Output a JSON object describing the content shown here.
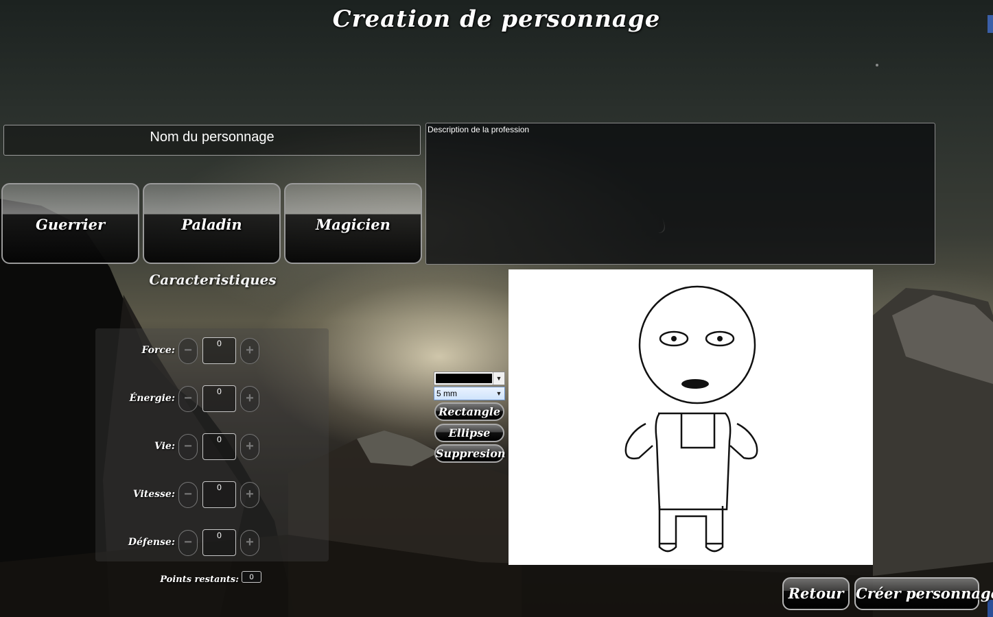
{
  "window": {
    "title": "Creation de personnage"
  },
  "name_field": {
    "value": "Nom du personnage"
  },
  "description": {
    "text": "Description de la profession"
  },
  "classes": [
    {
      "label": "Guerrier"
    },
    {
      "label": "Paladin"
    },
    {
      "label": "Magicien"
    }
  ],
  "characteristics": {
    "title": "Caracteristiques",
    "stats": [
      {
        "label": "Force:",
        "value": "0",
        "minus": "−",
        "plus": "+"
      },
      {
        "label": "Énergie:",
        "value": "0",
        "minus": "−",
        "plus": "+"
      },
      {
        "label": "Vie:",
        "value": "0",
        "minus": "−",
        "plus": "+"
      },
      {
        "label": "Vitesse:",
        "value": "0",
        "minus": "−",
        "plus": "+"
      },
      {
        "label": "Défense:",
        "value": "0",
        "minus": "−",
        "plus": "+"
      }
    ],
    "points_label": "Points restants:",
    "points_value": "0"
  },
  "drawing_tools": {
    "color_value": "#000000",
    "stroke_size": "5 mm",
    "rectangle_label": "Rectangle",
    "ellipse_label": "Ellipse",
    "delete_label": "Suppresion"
  },
  "footer": {
    "back_label": "Retour",
    "create_label": "Créer personnage"
  },
  "icons": {
    "dropdown": "chevron-down-icon"
  }
}
